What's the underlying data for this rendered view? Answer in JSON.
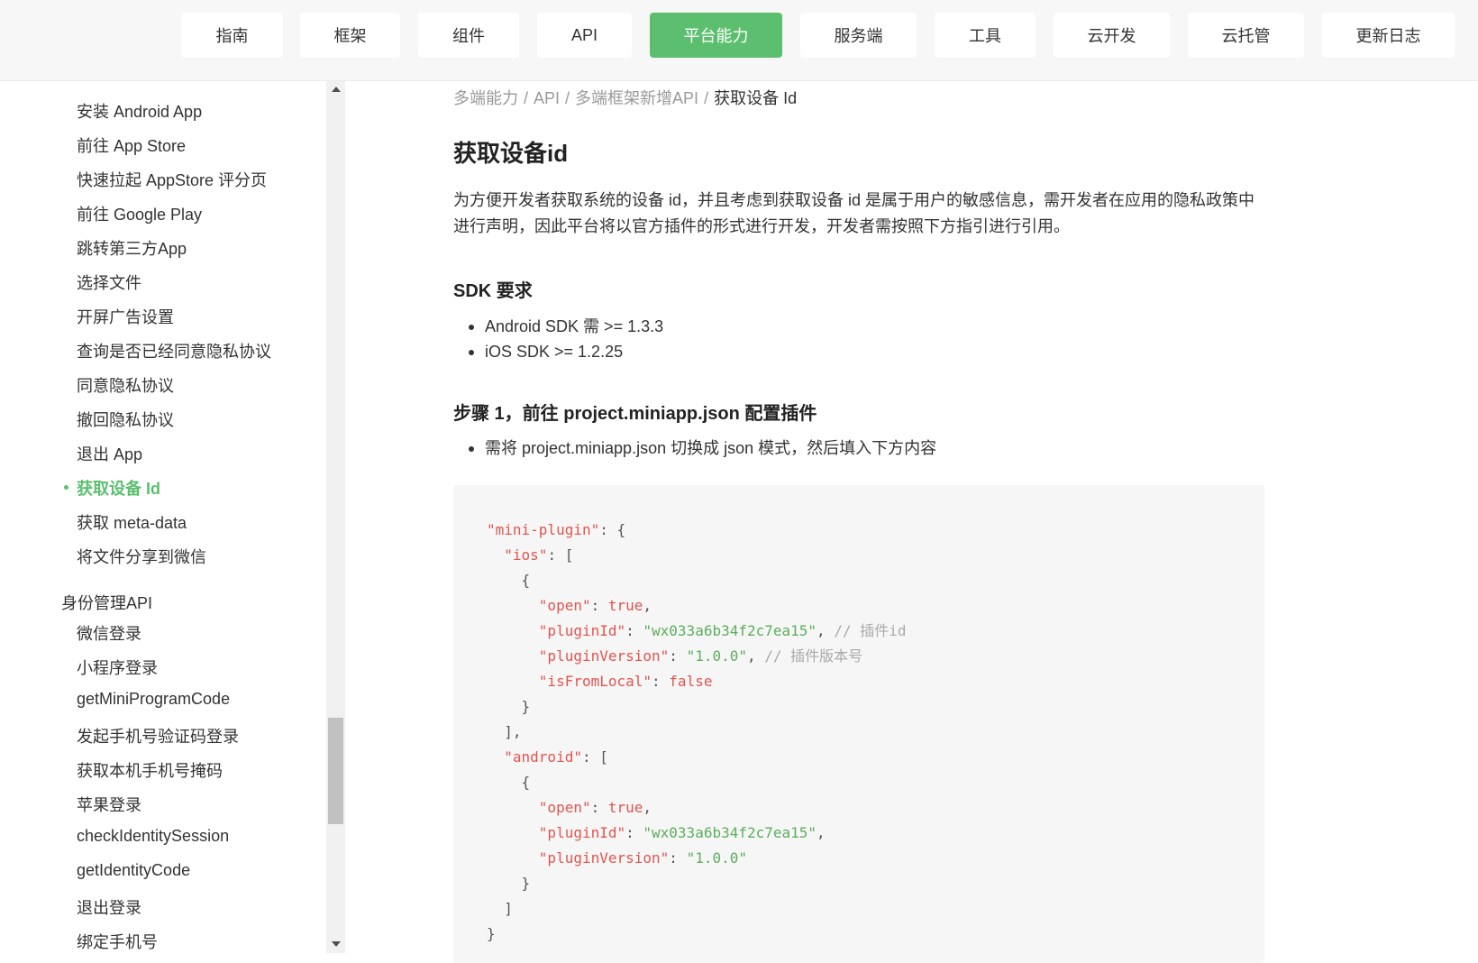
{
  "nav": {
    "items": [
      {
        "label": "指南"
      },
      {
        "label": "框架"
      },
      {
        "label": "组件"
      },
      {
        "label": "API"
      },
      {
        "label": "平台能力",
        "active": true
      },
      {
        "label": "服务端"
      },
      {
        "label": "工具"
      },
      {
        "label": "云开发"
      },
      {
        "label": "云托管"
      },
      {
        "label": "更新日志"
      }
    ],
    "accent_color": "#5cbf6f"
  },
  "sidebar": {
    "items": [
      "安装 Android App",
      "前往 App Store",
      "快速拉起 AppStore 评分页",
      "前往 Google Play",
      "跳转第三方App",
      "选择文件",
      "开屏广告设置",
      "查询是否已经同意隐私协议",
      "同意隐私协议",
      "撤回隐私协议",
      "退出 App",
      "获取设备 Id",
      "获取 meta-data",
      "将文件分享到微信"
    ],
    "active_item": "获取设备 Id",
    "group2_title": "身份管理API",
    "group2_items": [
      "微信登录",
      "小程序登录",
      "getMiniProgramCode",
      "发起手机号验证码登录",
      "获取本机手机号掩码",
      "苹果登录",
      "checkIdentitySession",
      "getIdentityCode",
      "退出登录",
      "绑定手机号"
    ]
  },
  "breadcrumb": {
    "items": [
      "多端能力",
      "API",
      "多端框架新增API"
    ],
    "current": "获取设备 Id",
    "separator": "/"
  },
  "content": {
    "title": "获取设备id",
    "intro": "为方便开发者获取系统的设备 id，并且考虑到获取设备 id 是属于用户的敏感信息，需开发者在应用的隐私政策中进行声明，因此平台将以官方插件的形式进行开发，开发者需按照下方指引进行引用。",
    "sdk_heading": "SDK 要求",
    "sdk_items": [
      "Android SDK 需 >= 1.3.3",
      "iOS SDK >= 1.2.25"
    ],
    "step1_heading": "步骤 1，前往 project.miniapp.json 配置插件",
    "step1_items": [
      "需将 project.miniapp.json 切换成 json 模式，然后填入下方内容"
    ]
  },
  "code": {
    "k_mini_plugin": "\"mini-plugin\"",
    "k_ios": "\"ios\"",
    "k_open": "\"open\"",
    "k_pluginId": "\"pluginId\"",
    "k_pluginVersion": "\"pluginVersion\"",
    "k_isFromLocal": "\"isFromLocal\"",
    "k_android": "\"android\"",
    "v_true": "true",
    "v_false": "false",
    "v_pluginId": "\"wx033a6b34f2c7ea15\"",
    "v_version": "\"1.0.0\"",
    "c_pluginId": "// 插件id",
    "c_version": "// 插件版本号"
  }
}
